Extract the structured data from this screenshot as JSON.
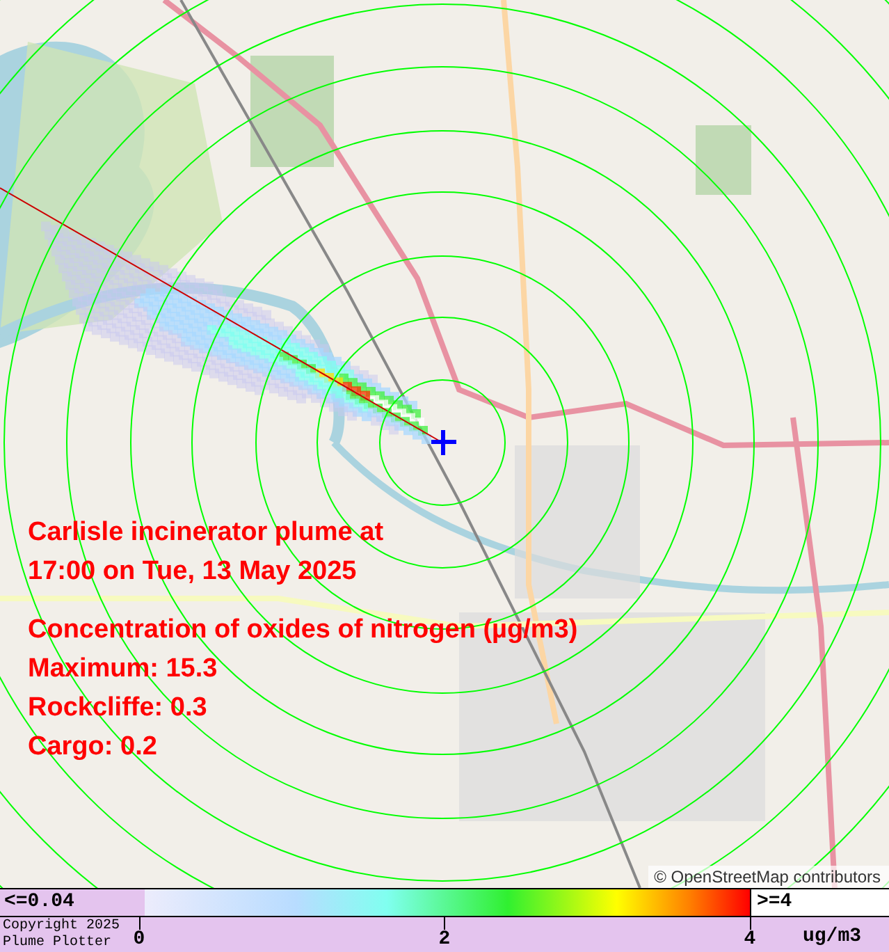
{
  "map": {
    "attribution": "© OpenStreetMap contributors",
    "title_lines": [
      "Carlisle incinerator plume at",
      "17:00 on Tue, 13 May 2025"
    ],
    "stats_lines": [
      "Concentration of oxides of nitrogen (µg/m3)",
      "Maximum: 15.3",
      "Rockcliffe: 0.3",
      "Cargo: 0.2"
    ]
  },
  "legend": {
    "low_label": "<=0.04",
    "high_label": ">=4",
    "ticks": [
      "0",
      "2",
      "4"
    ],
    "unit": "ug/m3",
    "copyright": [
      "Copyright 2025",
      "Plume Plotter"
    ]
  }
}
